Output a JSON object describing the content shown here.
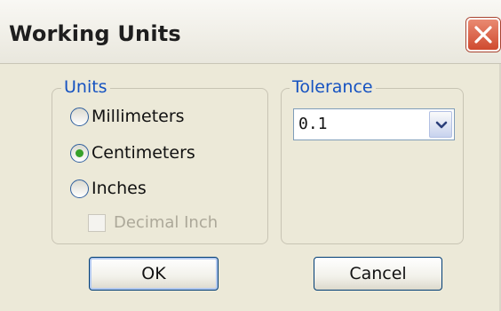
{
  "window": {
    "title": "Working Units",
    "close_icon": "close-icon",
    "colors": {
      "face": "#ece9d8",
      "group_label": "#1552c1",
      "close": "#cf4a2f",
      "radio_dot": "#37a12a"
    }
  },
  "units_group": {
    "label": "Units",
    "options": [
      {
        "label": "Millimeters",
        "checked": false
      },
      {
        "label": "Centimeters",
        "checked": true
      },
      {
        "label": "Inches",
        "checked": false
      }
    ],
    "decimal_inch": {
      "label": "Decimal Inch",
      "checked": false,
      "enabled": false
    }
  },
  "tolerance_group": {
    "label": "Tolerance",
    "selected": "0.1",
    "arrow_icon": "chevron-down-icon"
  },
  "buttons": {
    "ok": "OK",
    "cancel": "Cancel"
  }
}
